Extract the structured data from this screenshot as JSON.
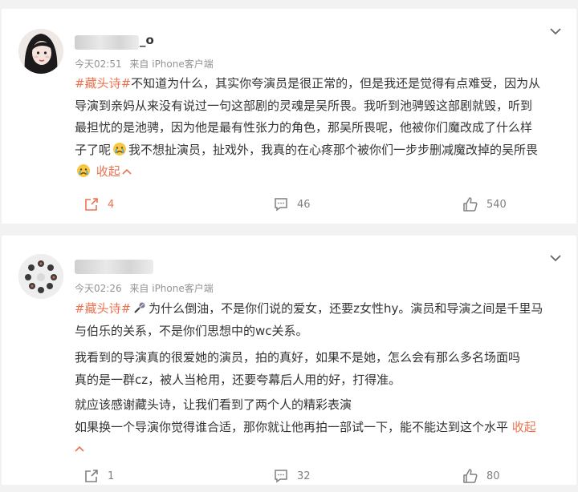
{
  "posts": [
    {
      "username_suffix": "_o",
      "time": "今天02:51",
      "source": "来自 iPhone客户端",
      "tag": "#藏头诗#",
      "lines": [
        "不知道为什么，其实你夸演员是很正常的，但是我还是觉得有点难受，因为从",
        "导演到亲妈从来没有说过一句这部剧的灵魂是吴所畏。我听到池骋毁这部剧就毁，听到",
        "最担忧的是池骋，因为他是最有性张力的角色，那吴所畏呢，他被你们魔改成了什么样",
        "子了呢",
        "我不想扯演员，扯戏外，我真的在心疼那个被你们一步步删减魔改掉的吴所畏"
      ],
      "collapse_label": "收起",
      "share_count": "4",
      "comment_count": "46",
      "like_count": "540"
    },
    {
      "time": "今天02:26",
      "source": "来自 iPhone客户端",
      "tag": "#藏头诗#",
      "lines": [
        "为什么倒油，不是你们说的爱女，还要z女性hy。演员和导演之间是千里马",
        "与伯乐的关系，不是你们思想中的wc关系。",
        "我看到的导演真的很爱她的演员，拍的真好，如果不是她，怎么会有那么多名场面吗",
        "真的是一群cz，被人当枪用，还要夸幕后人用的好，打得准。",
        "就应该感谢藏头诗，让我们看到了两个人的精彩表演",
        "如果换一个导演你觉得谁合适，那你就让他再拍一部试一下，能不能达到这个水平"
      ],
      "collapse_label": "收起",
      "share_count": "1",
      "comment_count": "32",
      "like_count": "80"
    }
  ],
  "colors": {
    "accent": "#eb7350",
    "meta": "#939393",
    "text": "#333333",
    "background": "#f2f2f2"
  },
  "icons": [
    "chevron-down-icon",
    "share-icon",
    "comment-icon",
    "like-icon",
    "sad-emoji-icon",
    "microphone-icon"
  ]
}
